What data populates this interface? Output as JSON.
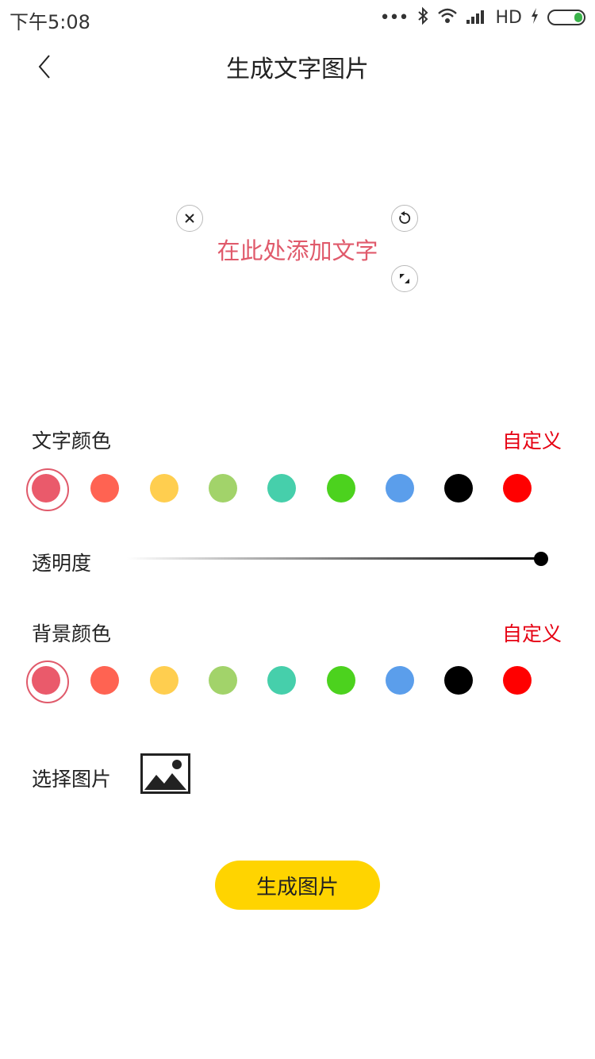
{
  "status_bar": {
    "time": "下午5:08",
    "dots": "•••",
    "network": "HD",
    "battery_color": "#3ab34a"
  },
  "header": {
    "title": "生成文字图片",
    "back_icon": "chevron-left-icon"
  },
  "editor": {
    "text": "在此处添加文字",
    "text_color": "#e05a6b",
    "handles": [
      "close-icon",
      "rotate-icon",
      "scale-icon"
    ]
  },
  "text_color": {
    "label": "文字颜色",
    "custom_label": "自定义",
    "selected_index": 0,
    "swatches": [
      "#ea5a6b",
      "#ff6352",
      "#ffce4f",
      "#a2d36a",
      "#46cfab",
      "#4cd21e",
      "#5b9eeb",
      "#000000",
      "#ff0000"
    ]
  },
  "opacity": {
    "label": "透明度",
    "value": 1.0
  },
  "background_color": {
    "label": "背景颜色",
    "custom_label": "自定义",
    "selected_index": 0,
    "swatches": [
      "#ea5a6b",
      "#ff6352",
      "#ffce4f",
      "#a2d36a",
      "#46cfab",
      "#4cd21e",
      "#5b9eeb",
      "#000000",
      "#ff0000"
    ]
  },
  "picture": {
    "label": "选择图片",
    "icon": "image-icon"
  },
  "actions": {
    "generate_label": "生成图片",
    "accent": "#ffd400"
  }
}
